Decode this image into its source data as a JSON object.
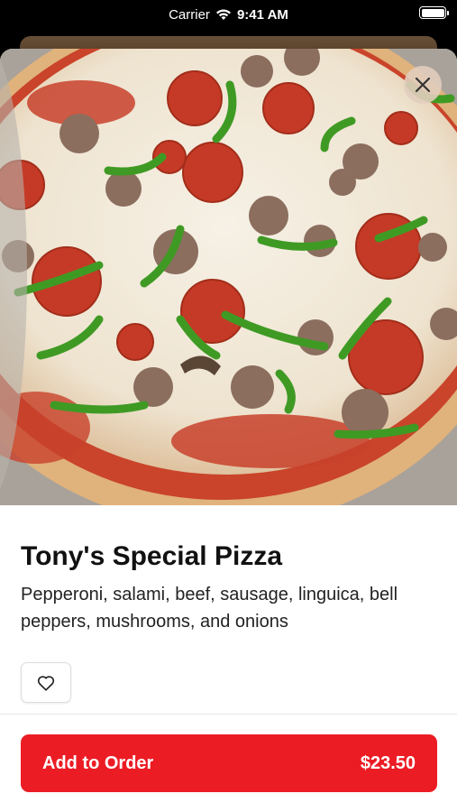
{
  "status_bar": {
    "carrier": "Carrier",
    "time": "9:41 AM"
  },
  "item": {
    "title": "Tony's Special Pizza",
    "description": "Pepperoni, salami, beef, sausage, linguica, bell peppers, mushrooms, and onions",
    "price": "$23.50"
  },
  "actions": {
    "add_label": "Add to Order",
    "close_icon": "close-icon",
    "favorite_icon": "heart-icon"
  },
  "colors": {
    "accent": "#ec1c24",
    "close_bg": "#e1cdbe"
  }
}
